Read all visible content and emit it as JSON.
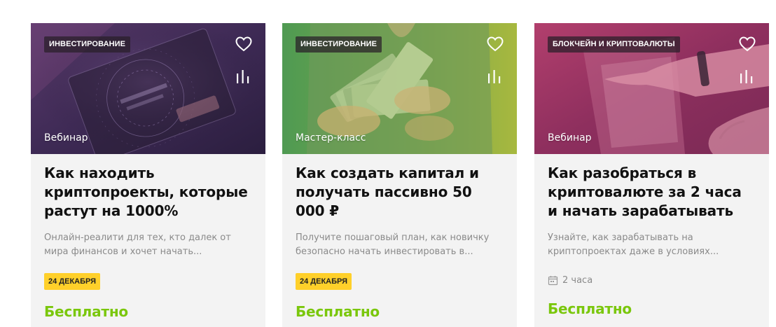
{
  "cards": [
    {
      "tag": "Инвестирование",
      "format": "Вебинар",
      "title": "Как находить криптопроекты, которые растут на 1000%",
      "description": "Онлайн-реалити для тех, кто далек от мира финансов и хочет начать...",
      "date": "24 декабря",
      "price": "Бесплатно",
      "icons": [
        "heart-icon",
        "stats-icon"
      ]
    },
    {
      "tag": "Инвестирование",
      "format": "Мастер-класс",
      "title": "Как создать капитал и получать пассивно 50 000 ₽",
      "description": "Получите пошаговый план, как новичку безопасно начать инвестировать в...",
      "date": "24 декабря",
      "price": "Бесплатно",
      "icons": [
        "heart-icon",
        "stats-icon"
      ]
    },
    {
      "tag": "Блокчейн и криптовалюты",
      "format": "Вебинар",
      "title": "Как разобраться в криптовалюте за 2 часа и начать зарабатывать",
      "description": "Узнайте, как зарабатывать на криптопроектах даже в условиях...",
      "duration": "2 часа",
      "price": "Бесплатно",
      "icons": [
        "heart-icon",
        "stats-icon",
        "calendar-icon"
      ]
    }
  ],
  "colors": {
    "price_green": "#7ac70c",
    "date_badge": "#ffd02a",
    "card_bg": "#f3f3f3",
    "overlay_purple": "#4b2a5c",
    "overlay_green": "#5ea04a",
    "overlay_magenta": "#9a2e63"
  }
}
